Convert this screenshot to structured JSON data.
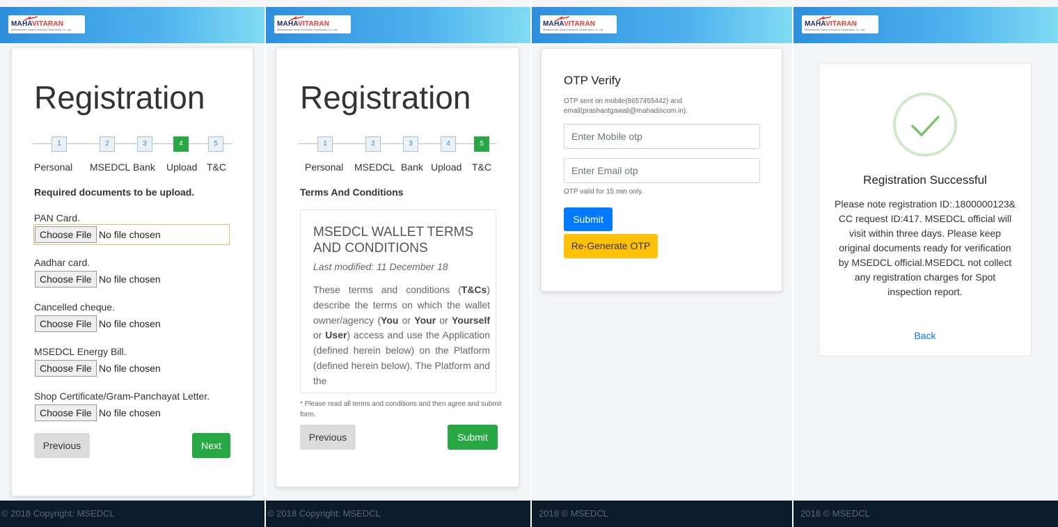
{
  "brand": {
    "logo_text_a": "MAHA",
    "logo_text_b": "VITARAN",
    "logo_tagline": "Maharashtra State Electricity Distribution Co. Ltd."
  },
  "steps": {
    "numbers": [
      "1",
      "2",
      "3",
      "4",
      "5"
    ],
    "labels": [
      "Personal",
      "MSEDCL",
      "Bank",
      "Upload",
      "T&C"
    ]
  },
  "upload": {
    "title": "Registration",
    "heading": "Required documents to be upload.",
    "file_button": "Choose File",
    "no_file": "No file chosen",
    "documents": [
      "PAN Card.",
      "Aadhar card.",
      "Cancelled cheque.",
      "MSEDCL Energy Bill.",
      "Shop Certificate/Gram-Panchayat Letter."
    ],
    "prev_label": "Previous",
    "next_label": "Next",
    "footer": "© 2018 Copyright: MSEDCL"
  },
  "terms": {
    "title": "Registration",
    "heading": "Terms And Conditions",
    "box_title": "MSEDCL WALLET TERMS AND CONDITIONS",
    "last_modified": "Last modified: 11 December 18",
    "body_1": "These terms and conditions (",
    "b_tcs": "T&Cs",
    "body_2": ") describe the terms on which the wallet owner/agency (",
    "b_you": "You",
    "or_1": " or ",
    "b_your": "Your",
    "or_2": " or ",
    "b_yourself": "Yourself",
    "or_3": " or ",
    "b_user": "User",
    "body_3": ") access and use the Application (defined herein below) on the Platform (defined herein below). The Platform and the",
    "note": "* Please read all terms and conditions and then agree and submit form.",
    "prev_label": "Previous",
    "submit_label": "Submit",
    "footer": "© 2018 Copyright: MSEDCL"
  },
  "otp": {
    "title": "OTP Verify",
    "sent_line1": "OTP sent on mobile(8657455442) and",
    "sent_line2": "email(prashantgawali@mahadiscom.in).",
    "mobile_placeholder": "Enter Mobile otp",
    "email_placeholder": "Enter Email otp",
    "validity": "OTP valid for 15 min only.",
    "submit_label": "Submit",
    "regen_label": "Re-Generate OTP",
    "footer": "2018 © MSEDCL"
  },
  "success": {
    "title": "Registration Successful",
    "message": "Please note registration ID:.1800000123& CC request ID:417. MSEDCL official will visit within three days. Please keep original documents ready for verification by MSEDCL official.MSEDCL not collect any registration charges for Spot inspection report.",
    "back_label": "Back",
    "footer": "2018 © MSEDCL",
    "check_icon": "check-circle-icon"
  },
  "colors": {
    "accent_green": "#28a745",
    "accent_blue": "#007bff",
    "accent_yellow": "#ffc107",
    "footer_bg": "#0c1a2e"
  }
}
